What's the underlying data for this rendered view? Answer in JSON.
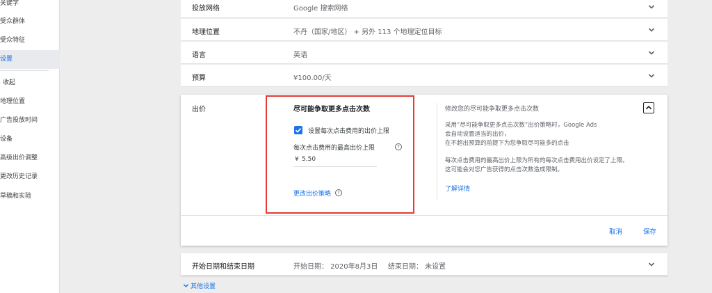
{
  "sidebar": {
    "items": [
      {
        "label": "关键字",
        "active": false
      },
      {
        "label": "受众群体",
        "active": false
      },
      {
        "label": "受众特征",
        "active": false
      },
      {
        "label": "设置",
        "active": true
      },
      {
        "label": "收起",
        "active": false
      },
      {
        "label": "地理位置",
        "active": false
      },
      {
        "label": "广告投放时间",
        "active": false
      },
      {
        "label": "设备",
        "active": false
      },
      {
        "label": "高级出价调整",
        "active": false
      },
      {
        "label": "更改历史记录",
        "active": false
      },
      {
        "label": "草稿和实验",
        "active": false
      }
    ]
  },
  "settings": {
    "network": {
      "label": "投放网络",
      "value": "Google 搜索网络"
    },
    "location": {
      "label": "地理位置",
      "value": "不丹（国家/地区） + 另外 113 个地理定位目标"
    },
    "language": {
      "label": "语言",
      "value": "英语"
    },
    "budget": {
      "label": "预算",
      "value": "¥100.00/天"
    },
    "dates": {
      "label": "开始日期和结束日期",
      "start": "开始日期：  2020年8月3日",
      "end": "结束日期：  未设置"
    }
  },
  "bidding": {
    "label": "出价",
    "strategy_title": "尽可能争取更多点击次数",
    "checkbox_label": "设置每次点击费用的出价上限",
    "checkbox_checked": true,
    "max_cpc_label": "每次点击费用的最高出价上限",
    "currency": "¥",
    "amount": "5.50",
    "change_strategy": "更改出价策略",
    "info_title": "修改您的尽可能争取更多点击次数",
    "info_lines": [
      "采用“尽可能争取更多点击次数”出价策略时，Google Ads",
      "会自动设置适当的出价，",
      "在不超出预算的前提下为您争取尽可能多的点击"
    ],
    "info_lines2": [
      "每次点击费用的最高出价上限为所有的每次点击费用出价设定了上限。",
      "这可能会对您广告获得的点击次数造成限制。"
    ],
    "learn_more": "了解详情",
    "cancel": "取消",
    "save": "保存"
  },
  "other_settings": "其他设置",
  "colors": {
    "accent": "#1a73e8",
    "highlight_box": "#e53935"
  }
}
